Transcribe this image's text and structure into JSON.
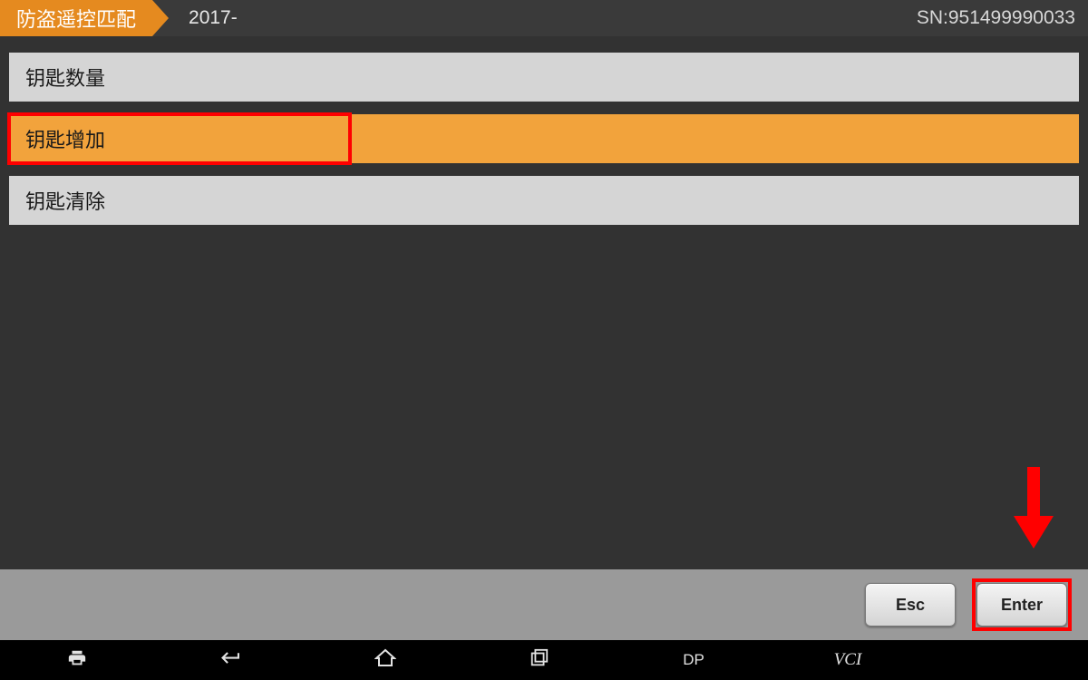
{
  "header": {
    "title": "防盗遥控匹配",
    "breadcrumb": "2017-",
    "sn_label": "SN:951499990033"
  },
  "menu": {
    "items": [
      {
        "label": "钥匙数量",
        "selected": false,
        "highlighted": false
      },
      {
        "label": "钥匙增加",
        "selected": true,
        "highlighted": true
      },
      {
        "label": "钥匙清除",
        "selected": false,
        "highlighted": false
      }
    ]
  },
  "footer": {
    "esc_label": "Esc",
    "enter_label": "Enter"
  },
  "navbar": {
    "dp_label": "DP",
    "vci_label": "VCI"
  },
  "colors": {
    "accent_orange": "#e58a1f",
    "selected_orange": "#f2a33c",
    "annotation_red": "#ff0000"
  }
}
